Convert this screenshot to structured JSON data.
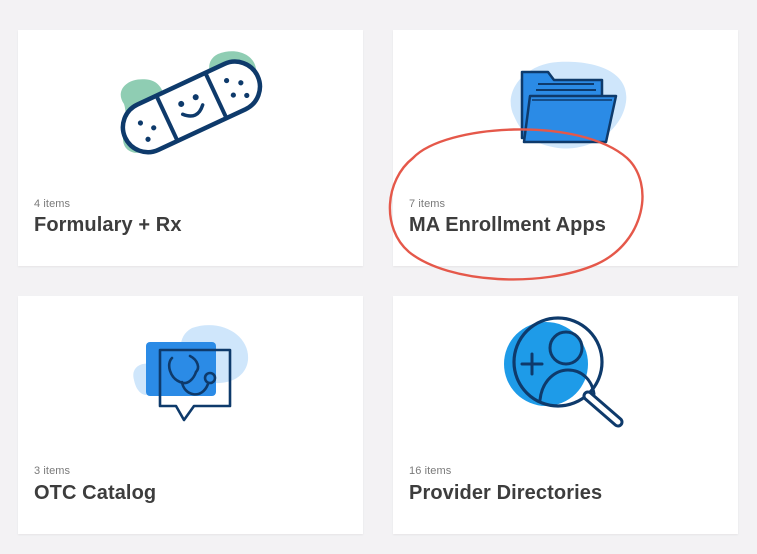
{
  "cards": [
    {
      "title": "Formulary + Rx",
      "count": "4 items",
      "icon": "bandage-icon"
    },
    {
      "title": "MA Enrollment Apps",
      "count": "7 items",
      "icon": "folder-icon"
    },
    {
      "title": "OTC Catalog",
      "count": "3 items",
      "icon": "stethoscope-chat-icon"
    },
    {
      "title": "Provider Directories",
      "count": "16 items",
      "icon": "search-user-icon"
    }
  ],
  "colors": {
    "background": "#f3f2f4",
    "card": "#ffffff",
    "navy": "#0e3a6b",
    "blue": "#2b8be6",
    "light_blue": "#cfe6fb",
    "mint": "#8fcdb3",
    "highlight": "#e5584a"
  }
}
